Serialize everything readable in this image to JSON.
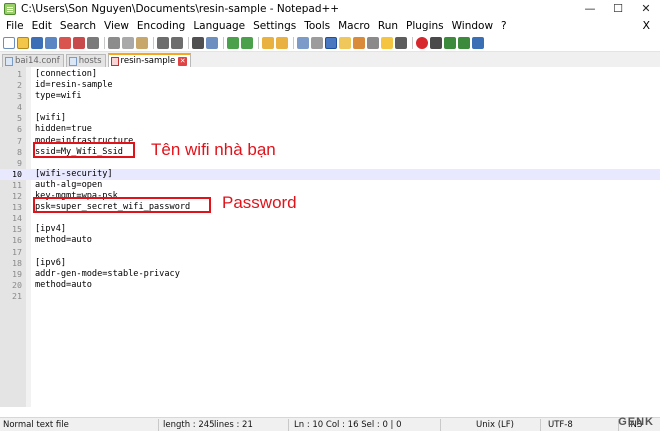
{
  "window": {
    "title": "C:\\Users\\Son Nguyen\\Documents\\resin-sample - Notepad++",
    "minimize": "—",
    "maximize": "☐",
    "close": "✕"
  },
  "menu": {
    "items": [
      "File",
      "Edit",
      "Search",
      "View",
      "Encoding",
      "Language",
      "Settings",
      "Tools",
      "Macro",
      "Run",
      "Plugins",
      "Window",
      "?"
    ],
    "close": "X"
  },
  "tabs": [
    {
      "label": "bai14.conf",
      "active": false
    },
    {
      "label": "hosts",
      "active": false
    },
    {
      "label": "resin-sample",
      "active": true
    }
  ],
  "editor": {
    "current_line": 10,
    "lines": [
      {
        "n": "1",
        "text": "[connection]"
      },
      {
        "n": "2",
        "text": "id=resin-sample"
      },
      {
        "n": "3",
        "text": "type=wifi"
      },
      {
        "n": "4",
        "text": ""
      },
      {
        "n": "5",
        "text": "[wifi]"
      },
      {
        "n": "6",
        "text": "hidden=true"
      },
      {
        "n": "7",
        "text": "mode=infrastructure"
      },
      {
        "n": "8",
        "text": "ssid=My_Wifi_Ssid"
      },
      {
        "n": "9",
        "text": ""
      },
      {
        "n": "10",
        "text": "[wifi-security]"
      },
      {
        "n": "11",
        "text": "auth-alg=open"
      },
      {
        "n": "12",
        "text": "key-mgmt=wpa-psk"
      },
      {
        "n": "13",
        "text": "psk=super_secret_wifi_password"
      },
      {
        "n": "14",
        "text": ""
      },
      {
        "n": "15",
        "text": "[ipv4]"
      },
      {
        "n": "16",
        "text": "method=auto"
      },
      {
        "n": "17",
        "text": ""
      },
      {
        "n": "18",
        "text": "[ipv6]"
      },
      {
        "n": "19",
        "text": "addr-gen-mode=stable-privacy"
      },
      {
        "n": "20",
        "text": "method=auto"
      },
      {
        "n": "21",
        "text": ""
      }
    ]
  },
  "annotations": {
    "ssid_label": "Tên wifi nhà bạn",
    "psk_label": "Password",
    "color": "#e0131b"
  },
  "status": {
    "file_type": "Normal text file",
    "length": "length : 245",
    "lines": "lines : 21",
    "position": "Ln : 10   Col : 16   Sel : 0 | 0",
    "eol": "Unix (LF)",
    "encoding": "UTF-8",
    "mode": "INS"
  },
  "watermark": "GENK"
}
